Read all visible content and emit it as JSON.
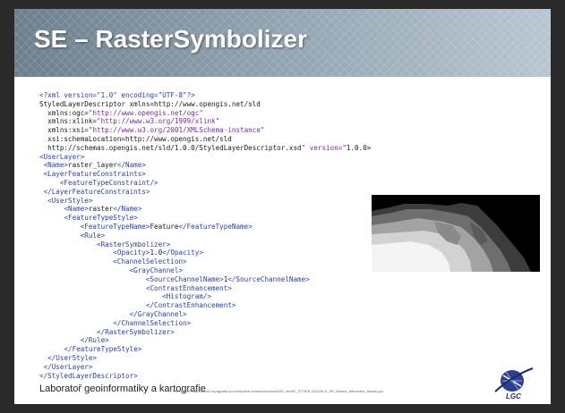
{
  "slide": {
    "title": "SE – RasterSymbolizer",
    "code_lines": [
      "<?xml version=\"1.0\" encoding=\"UTF-8\"?>",
      "<StyledLayerDescriptor xmlns=http://www.opengis.net/sld",
      "  xmlns:ogc=\"http://www.opengis.net/ogc\"",
      "  xmlns:xlink=\"http://www.w3.org/1999/xlink\"",
      "  xmlns:xsi=\"http://www.w3.org/2001/XMLSchema-instance\"",
      "  xsi:schemaLocation=\"http://www.opengis.net/sld",
      "  http://schemas.opengis.net/sld/1.0.0/StyledLayerDescriptor.xsd\" version=\"1.0.0\">",
      "<UserLayer>",
      " <Name>raster_layer</Name>",
      " <LayerFeatureConstraints>",
      "     <FeatureTypeConstraint/>",
      " </LayerFeatureConstraints>",
      "  <UserStyle>",
      "      <Name>raster</Name>",
      "      <FeatureTypeStyle>",
      "          <FeatureTypeName>Feature</FeatureTypeName>",
      "          <Rule>",
      "              <RasterSymbolizer>",
      "                  <Opacity>1.0</Opacity>",
      "                  <ChannelSelection>",
      "                      <GrayChannel>",
      "                          <SourceChannelName>1</SourceChannelName>",
      "                          <ContrastEnhancement>",
      "                              <Histogram/>",
      "                          </ContrastEnhancement>",
      "                      </GrayChannel>",
      "                  </ChannelSelection>",
      "              </RasterSymbolizer>",
      "          </Rule>",
      "      </FeatureTypeStyle>",
      "  </UserStyle>",
      " </UserLayer>",
      "</StyledLayerDescriptor>"
    ],
    "raster_image": "raster-preview-image",
    "footer": {
      "text": "Laboratoř geoinformatiky a kartografie",
      "source": "Převzato z: http://www2.topografia.upm.es/pdi/m.manso/docencia/IDE_ster92_ITT/IDE-2010/SLD_SE_Marina_Mercedes_Adrian.ppt",
      "logo_label": "LGC"
    },
    "colors": {
      "header_start": "#6b7f8c",
      "header_end": "#b9c6cf",
      "tag": "#2a3fb5",
      "string": "#7b2aa0"
    }
  }
}
